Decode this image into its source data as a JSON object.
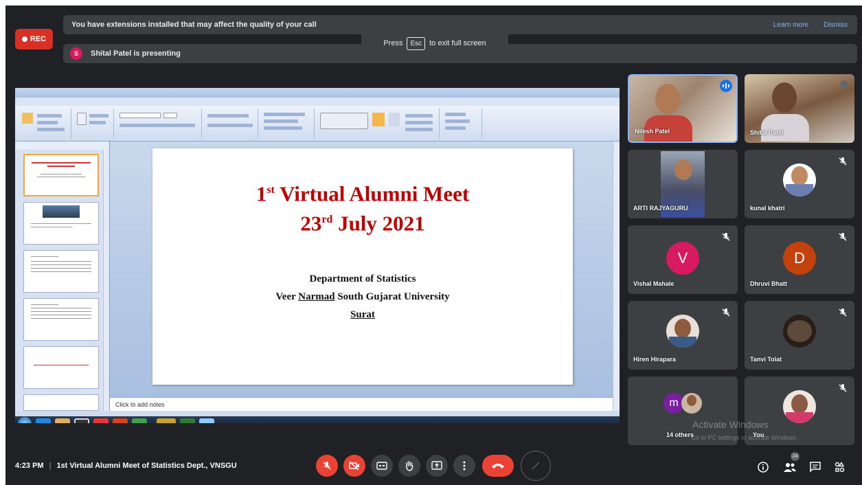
{
  "banners": {
    "rec_label": "REC",
    "extensions_notice": "You have extensions installed that may affect the quality of your call",
    "learn_more": "Learn more",
    "dismiss": "Dismiss",
    "presenter_initial": "S",
    "presenting_notice": "Shital Patel is presenting",
    "esc_prefix": "Press",
    "esc_key": "Esc",
    "esc_suffix": "to exit full screen"
  },
  "slide": {
    "title_line1_num": "1",
    "title_line1_sup": "st",
    "title_line1_rest": " Virtual  Alumni Meet",
    "title_line2_num": "23",
    "title_line2_sup": "rd",
    "title_line2_rest": " July 2021",
    "dept": "Department  of Statistics",
    "univ_pre": "Veer ",
    "univ_underlined": "Narmad",
    "univ_post": " South Gujarat University",
    "city": "Surat",
    "notes_placeholder": "Click to add notes"
  },
  "participants": [
    {
      "name": "Nilesh Patel",
      "type": "video",
      "speaking": true
    },
    {
      "name": "Shital Patel",
      "type": "video",
      "speaking": false
    },
    {
      "name": "ARTI RAJYAGURU",
      "type": "video",
      "muted": false
    },
    {
      "name": "kunal khatri",
      "type": "photo",
      "muted": true
    },
    {
      "name": "Vishal Mahale",
      "initial": "V",
      "color": "#d81b60",
      "muted": true
    },
    {
      "name": "Dhruvi Bhatt",
      "initial": "D",
      "color": "#c2410c",
      "muted": true
    },
    {
      "name": "Hiren Hirapara",
      "type": "photo",
      "muted": true
    },
    {
      "name": "Tanvi Tolat",
      "type": "photo",
      "muted": true
    },
    {
      "name": "14 others",
      "initial": "m",
      "color": "#7b1fa2"
    },
    {
      "name": "You",
      "type": "photo",
      "muted": true
    }
  ],
  "watermark": {
    "line1": "Activate Windows",
    "line2": "Go to PC settings to activate Windows."
  },
  "bottom_bar": {
    "time": "4:23 PM",
    "separator": "|",
    "meeting_title": "1st Virtual Alumni Meet of Statistics Dept., VNSGU",
    "participant_count": "24",
    "accent_red": "#ea4335"
  }
}
